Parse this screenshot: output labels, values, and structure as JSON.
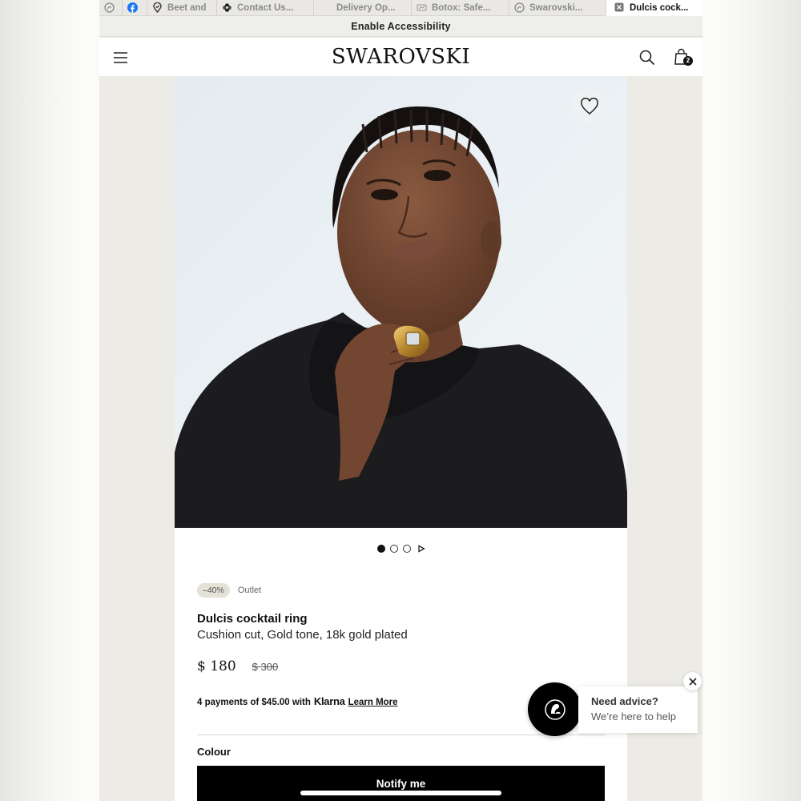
{
  "tabs": [
    {
      "label": "",
      "icon": "swan-icon"
    },
    {
      "label": "",
      "icon": "facebook-icon"
    },
    {
      "label": "Beet and",
      "icon": "location-pin-icon"
    },
    {
      "label": "Contact Us...",
      "icon": "flower-icon"
    },
    {
      "label": "Delivery Op...",
      "icon": "blank-page-icon"
    },
    {
      "label": "Botox: Safe...",
      "icon": "site-icon"
    },
    {
      "label": "Swarovski...",
      "icon": "swan-icon"
    },
    {
      "label": "Dulcis cock...",
      "icon": "close-icon",
      "active": true
    }
  ],
  "accessibility": {
    "label": "Enable Accessibility"
  },
  "header": {
    "logo": "SWAROVSKI",
    "bag_count": "2"
  },
  "product": {
    "discount": "–40%",
    "outlet": "Outlet",
    "title": "Dulcis cocktail ring",
    "subtitle": "Cushion cut, Gold tone, 18k gold plated",
    "price_now": "$ 180",
    "price_was": "$ 300",
    "klarna_text": "4 payments of $45.00 with",
    "klarna_brand": "Klarna",
    "klarna_link": "Learn More",
    "colour_label": "Colour",
    "notify_label": "Notify me"
  },
  "carousel": {
    "slides": 3,
    "active_index": 0
  },
  "chat": {
    "title": "Need advice?",
    "subtitle": "We’re here to help"
  },
  "colors": {
    "accent": "#000000",
    "badge_bg": "#e4e1d7",
    "page_bg": "#edebe5"
  }
}
